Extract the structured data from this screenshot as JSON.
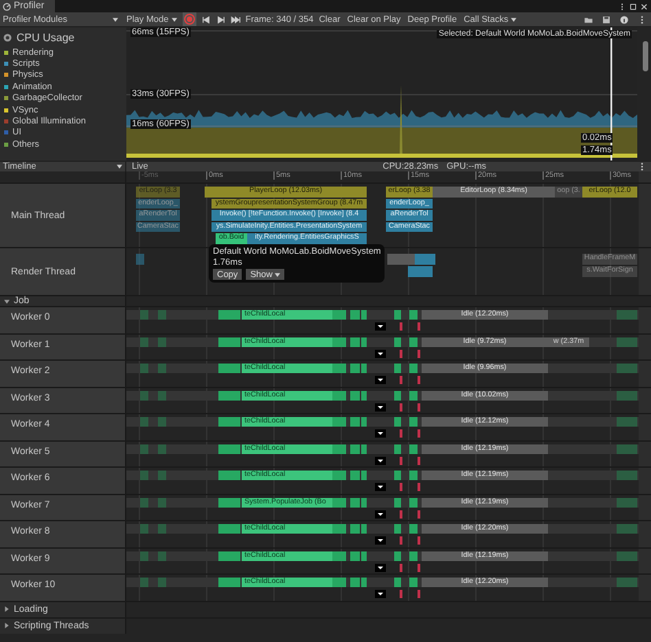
{
  "window": {
    "title": "Profiler"
  },
  "toolbar": {
    "modules_label": "Profiler Modules",
    "play_mode": "Play Mode",
    "recording": true,
    "frame": "Frame: 340 / 354",
    "buttons": [
      {
        "label": "Clear",
        "selected": false
      },
      {
        "label": "Clear on Play",
        "selected": false
      },
      {
        "label": "Deep Profile",
        "selected": false
      }
    ],
    "call_stacks": "Call Stacks"
  },
  "cpu_module": {
    "title": "CPU Usage",
    "legend": [
      {
        "name": "Rendering",
        "color": "#9eb53a"
      },
      {
        "name": "Scripts",
        "color": "#3d8fb5"
      },
      {
        "name": "Physics",
        "color": "#d4922a"
      },
      {
        "name": "Animation",
        "color": "#2ca4b3"
      },
      {
        "name": "GarbageCollector",
        "color": "#8a9a3a"
      },
      {
        "name": "VSync",
        "color": "#d8c42e"
      },
      {
        "name": "Global Illumination",
        "color": "#9c3d2d"
      },
      {
        "name": "UI",
        "color": "#2f5ea8"
      },
      {
        "name": "Others",
        "color": "#6b9e44"
      }
    ],
    "guide_labels": [
      "66ms (15FPS)",
      "33ms (30FPS)",
      "16ms (60FPS)"
    ],
    "selected_label": "Selected: Default World MoMoLab.BoidMoveSystem",
    "readings": [
      "0.02ms",
      "1.74ms"
    ]
  },
  "timeline": {
    "view": "Timeline",
    "mode": "Live",
    "cpu": "CPU:28.23ms",
    "gpu": "GPU:--ms",
    "ticks": [
      "-5ms",
      "0ms",
      "5ms",
      "10ms",
      "15ms",
      "20ms",
      "25ms",
      "30ms"
    ],
    "main_thread": {
      "name": "Main Thread",
      "samples": [
        {
          "kind": "loop",
          "faded": true,
          "label": "erLoop (3.3",
          "children": [
            {
              "kind": "script",
              "faded": true,
              "label": "enderLoop_",
              "children": [
                {
                  "kind": "script",
                  "faded": true,
                  "label": "aRenderTol",
                  "children": [
                    {
                      "kind": "script",
                      "faded": true,
                      "label": "CameraStac"
                    }
                  ]
                }
              ]
            }
          ]
        },
        {
          "kind": "loop",
          "faded": false,
          "label": "PlayerLoop (12.03ms)",
          "children": [
            {
              "kind": "loop",
              "faded": false,
              "label": "ystemGroupresentationSystemGroup (8.47m",
              "children": [
                {
                  "kind": "script",
                  "faded": false,
                  "label": "Invoke() [!teFunction.Invoke() [Invoke] (8.4",
                  "children": [
                    {
                      "kind": "script",
                      "faded": false,
                      "label": "ys.SimulateInity.Entities.PresentationSystem",
                      "children": [
                        {
                          "kind": "job",
                          "faded": false,
                          "label": "ob.Boid"
                        },
                        {
                          "kind": "script",
                          "faded": false,
                          "label": "ity.Rendering.EntitiesGraphicsS"
                        }
                      ]
                    }
                  ]
                }
              ]
            }
          ]
        },
        {
          "kind": "loop",
          "faded": false,
          "label": "erLoop (3.38",
          "children": [
            {
              "kind": "script",
              "faded": false,
              "label": "enderLoop_",
              "children": [
                {
                  "kind": "script",
                  "faded": false,
                  "label": "aRenderTol",
                  "children": [
                    {
                      "kind": "script",
                      "faded": false,
                      "label": "CameraStac"
                    }
                  ]
                }
              ]
            }
          ]
        },
        {
          "kind": "editor",
          "faded": false,
          "label": "EditorLoop (8.34ms)"
        },
        {
          "kind": "editor",
          "faded": true,
          "label": "oop (3."
        },
        {
          "kind": "loop",
          "faded": false,
          "label": "erLoop (12.0"
        }
      ]
    },
    "tooltip": {
      "title": "Default World MoMoLab.BoidMoveSystem",
      "duration": "1.76ms",
      "buttons": [
        "Copy",
        "Show"
      ]
    },
    "render_thread": {
      "name": "Render Thread",
      "labels": [
        "HandleFrameM",
        "s.WaitForSign"
      ]
    },
    "job_group": {
      "name": "Job",
      "expanded": true
    },
    "workers": [
      {
        "name": "Worker 0",
        "job_label": "teChildLocal",
        "idle": "Idle (12.20ms)"
      },
      {
        "name": "Worker 1",
        "job_label": "teChildLocal",
        "idle": "Idle (9.72ms)",
        "extra": "w (2.37m"
      },
      {
        "name": "Worker 2",
        "job_label": "teChildLocal",
        "idle": "Idle (9.96ms)"
      },
      {
        "name": "Worker 3",
        "job_label": "teChildLocal",
        "idle": "Idle (10.02ms)"
      },
      {
        "name": "Worker 4",
        "job_label": "teChildLocal",
        "idle": "Idle (12.12ms)"
      },
      {
        "name": "Worker 5",
        "job_label": "teChildLocal",
        "idle": "Idle (12.19ms)"
      },
      {
        "name": "Worker 6",
        "job_label": "teChildLocal",
        "idle": "Idle (12.19ms)"
      },
      {
        "name": "Worker 7",
        "job_label": "System.PopulateJob (Bo",
        "idle": "Idle (12.19ms)"
      },
      {
        "name": "Worker 8",
        "job_label": "teChildLocal",
        "idle": "Idle (12.20ms)"
      },
      {
        "name": "Worker 9",
        "job_label": "teChildLocal",
        "idle": "Idle (12.19ms)"
      },
      {
        "name": "Worker 10",
        "job_label": "teChildLocal",
        "idle": "Idle (12.20ms)"
      }
    ],
    "groups": [
      {
        "name": "Loading",
        "expanded": false
      },
      {
        "name": "Scripting Threads",
        "expanded": false
      }
    ]
  }
}
